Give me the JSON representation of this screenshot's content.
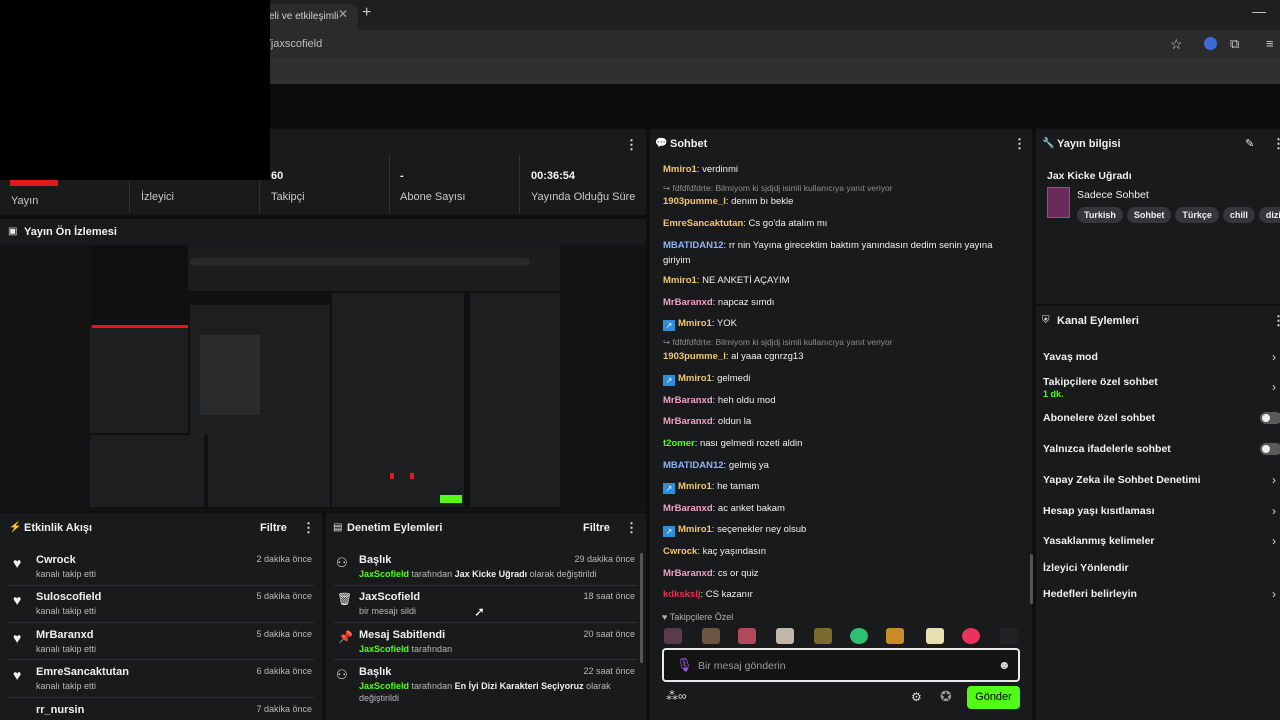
{
  "browser": {
    "tab_title": "zeli ve etkileşimli",
    "tab_close": "✕",
    "new_tab": "+",
    "url": "or/jaxscofield",
    "minimize": "—"
  },
  "stats": {
    "live_label": "Yayın",
    "viewers_label": "İzleyici",
    "followers_value": "60",
    "followers_label": "Takipçi",
    "subs_value": "-",
    "subs_label": "Abone Sayısı",
    "uptime_value": "00:36:54",
    "uptime_label": "Yayında Olduğu Süre"
  },
  "preview": {
    "title": "Yayın Ön İzlemesi"
  },
  "feed": {
    "title": "Etkinlik Akışı",
    "filter": "Filtre",
    "items": [
      {
        "name": "Cwrock",
        "sub": "kanalı takip etti",
        "time": "2 dakika önce"
      },
      {
        "name": "Suloscofield",
        "sub": "kanalı takip etti",
        "time": "5 dakika önce"
      },
      {
        "name": "MrBaranxd",
        "sub": "kanalı takip etti",
        "time": "5 dakika önce"
      },
      {
        "name": "EmreSancaktutan",
        "sub": "kanalı takip etti",
        "time": "6 dakika önce"
      },
      {
        "name": "rr_nursin",
        "sub": "",
        "time": "7 dakika önce"
      }
    ]
  },
  "mod": {
    "title": "Denetim Eylemleri",
    "filter": "Filtre",
    "items": [
      {
        "name": "Başlık",
        "user": "JaxScofield",
        "mid": "tarafından",
        "bold": "Jax Kicke Uğradı",
        "tail": "olarak değiştirildi",
        "time": "29 dakika önce"
      },
      {
        "name": "JaxScofield",
        "sub": "bir mesajı sildi",
        "time": "18 saat önce"
      },
      {
        "name": "Mesaj Sabitlendi",
        "user": "JaxScofield",
        "mid": "tarafından",
        "time": "20 saat önce"
      },
      {
        "name": "Başlık",
        "user": "JaxScofield",
        "mid": "tarafından",
        "bold": "En İyi Dizi Karakteri Seçiyoruz",
        "tail": "olarak",
        "tail2": "değiştirildi",
        "time": "22 saat önce"
      }
    ]
  },
  "chat": {
    "title": "Sohbet",
    "messages": [
      {
        "user": "Mmiro1",
        "color": "#f0c674",
        "text": "verdinmi"
      },
      {
        "reply": "fdfdfdfdrte: Bilmiyom ki sjdjdj isimli kullanıcıya yanıt veriyor"
      },
      {
        "user": "1903pumme_l",
        "color": "#f0c674",
        "text": "denım bı bekle"
      },
      {
        "user": "EmreSancaktutan",
        "color": "#f0c674",
        "text": "Cs go'da atalım mı"
      },
      {
        "user": "MBATIDAN12",
        "color": "#8ab4f8",
        "text": "rr nin Yayına girecektim baktım yanındasın dedim senin yayına",
        "text2": "giriyim"
      },
      {
        "user": "Mmiro1",
        "color": "#f0c674",
        "text": "NE ANKETİ AÇAYIM"
      },
      {
        "user": "MrBaranxd",
        "color": "#f2a0c4",
        "text": "napcaz sımdı"
      },
      {
        "user": "Mmiro1",
        "color": "#f0c674",
        "text": "YOK",
        "badge": true
      },
      {
        "reply": "fdfdfdfdrte: Bilmiyom ki sjdjdj isimli kullanıcıya yanıt veriyor"
      },
      {
        "user": "1903pumme_l",
        "color": "#f0c674",
        "text": "al yaaa cgnrzg13"
      },
      {
        "user": "Mmiro1",
        "color": "#f0c674",
        "text": "gelmedi",
        "badge": true
      },
      {
        "user": "MrBaranxd",
        "color": "#f2a0c4",
        "text": "heh oldu mod"
      },
      {
        "user": "MrBaranxd",
        "color": "#f2a0c4",
        "text": "oldun la"
      },
      {
        "user": "t2omer",
        "color": "#53fc18",
        "text": "nası gelmedi rozeti aldin"
      },
      {
        "user": "MBATIDAN12",
        "color": "#8ab4f8",
        "text": "gelmiş ya"
      },
      {
        "user": "Mmiro1",
        "color": "#f0c674",
        "text": "he tamam",
        "badge": true
      },
      {
        "user": "MrBaranxd",
        "color": "#f2a0c4",
        "text": "ac anket bakam"
      },
      {
        "user": "Mmiro1",
        "color": "#f0c674",
        "text": "seçenekler ney olsub",
        "badge": true
      },
      {
        "user": "Cwrock",
        "color": "#f0c674",
        "text": "kaç yaşındasın"
      },
      {
        "user": "MrBaranxd",
        "color": "#f2a0c4",
        "text": "cs or quiz"
      },
      {
        "user": "kdkskslj",
        "color": "#e2324a",
        "text": "CS kazanır"
      }
    ],
    "followers_only": "Takipçilere Özel",
    "input_placeholder": "Bir mesaj gönderin",
    "send": "Gönder"
  },
  "info": {
    "title": "Yayın bilgisi",
    "stream_title": "Jax Kicke Uğradı",
    "category": "Sadece Sohbet",
    "tags": [
      "Turkish",
      "Sohbet",
      "Türkçe",
      "chill",
      "dizi"
    ]
  },
  "actions": {
    "title": "Kanal Eylemleri",
    "items": [
      {
        "label": "Yavaş mod",
        "kind": "arrow"
      },
      {
        "label": "Takipçilere özel sohbet",
        "sub": "1 dk.",
        "kind": "arrow"
      },
      {
        "label": "Abonelere özel sohbet",
        "kind": "toggle"
      },
      {
        "label": "Yalnızca ifadelerle sohbet",
        "kind": "toggle"
      },
      {
        "label": "Yapay Zeka ile Sohbet Denetimi",
        "kind": "arrow"
      },
      {
        "label": "Hesap yaşı kısıtlaması",
        "kind": "arrow"
      },
      {
        "label": "Yasaklanmış kelimeler",
        "kind": "arrow"
      },
      {
        "label": "İzleyici Yönlendir",
        "kind": "none"
      },
      {
        "label": "Hedefleri belirleyin",
        "kind": "arrow"
      }
    ]
  },
  "colors": {
    "accent": "#53fc18",
    "panel": "#191a1c",
    "live": "#e3171e"
  }
}
